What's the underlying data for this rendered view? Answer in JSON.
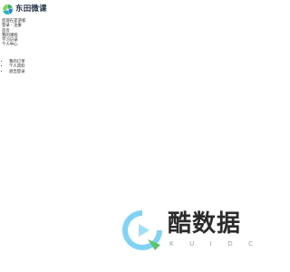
{
  "brand": {
    "name": "东田微课",
    "logo_icon": "pinwheel-logo-icon"
  },
  "links": [
    "您现在是游客",
    "登录 · 注册",
    "首页",
    "我的课程",
    "学习记录",
    "个人中心"
  ],
  "menu": [
    "我的订单",
    "个人资料",
    "退出登录"
  ],
  "watermark": {
    "title": "酷数据",
    "subtitle_letters": [
      "K",
      "U",
      "I",
      "D",
      "C"
    ],
    "icon": "play-logo-icon"
  },
  "colors": {
    "brand_text": "#1f2d44",
    "logo_green": "#3cb371",
    "logo_blue": "#2f80ed",
    "logo_teal": "#25b7b0",
    "watermark_blue": "#7fd3f5",
    "watermark_green": "#5cc46a"
  }
}
